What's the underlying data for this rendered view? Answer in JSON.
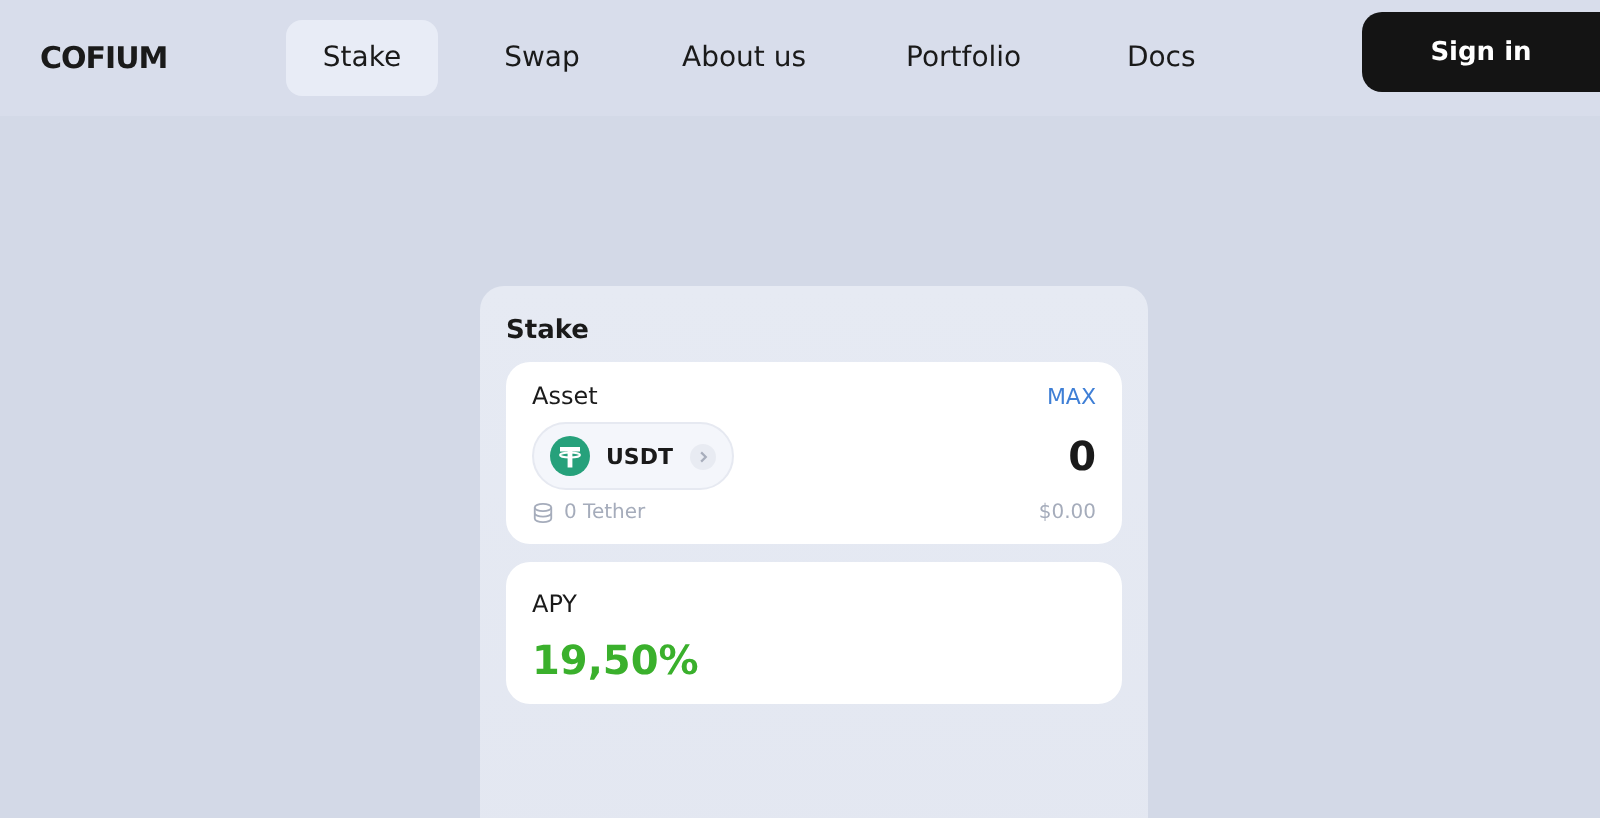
{
  "logo": "COFIUM",
  "nav": [
    {
      "label": "Stake",
      "selected": true
    },
    {
      "label": "Swap",
      "selected": false
    },
    {
      "label": "About us",
      "selected": false
    },
    {
      "label": "Portfolio",
      "selected": false
    },
    {
      "label": "Docs",
      "selected": false
    }
  ],
  "sign_in": "Sign in",
  "stake_card": {
    "title": "Stake",
    "asset": {
      "label": "Asset",
      "max": "MAX",
      "token": "USDT",
      "amount": "0",
      "balance": "0 Tether",
      "usd_value": "$0.00"
    },
    "apy": {
      "label": "APY",
      "value": "19,50%"
    }
  }
}
